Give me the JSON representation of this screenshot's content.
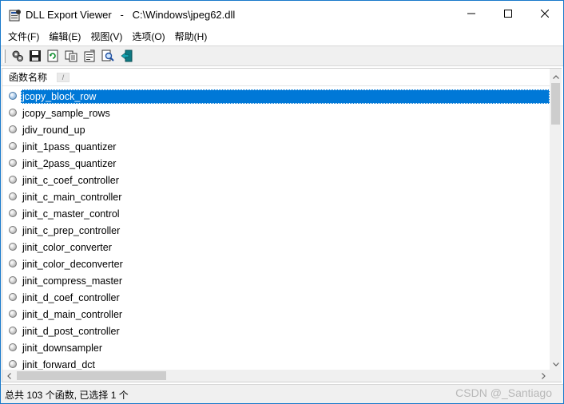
{
  "window": {
    "title": "DLL Export Viewer   -   C:\\Windows\\jpeg62.dll",
    "minimize_icon": "minimize-icon",
    "maximize_icon": "maximize-icon",
    "close_icon": "close-icon"
  },
  "menu": {
    "items": [
      {
        "label": "文件(F)"
      },
      {
        "label": "编辑(E)"
      },
      {
        "label": "视图(V)"
      },
      {
        "label": "选项(O)"
      },
      {
        "label": "帮助(H)"
      }
    ]
  },
  "toolbar": {
    "buttons": [
      {
        "icon": "properties-gear-icon"
      },
      {
        "icon": "save-icon"
      },
      {
        "icon": "refresh-icon"
      },
      {
        "icon": "copy-icon"
      },
      {
        "icon": "html-report-icon"
      },
      {
        "icon": "find-icon"
      },
      {
        "icon": "exit-icon"
      }
    ]
  },
  "list": {
    "column_header": "函数名称",
    "sort_indicator": "/",
    "selected_index": 0,
    "rows": [
      "jcopy_block_row",
      "jcopy_sample_rows",
      "jdiv_round_up",
      "jinit_1pass_quantizer",
      "jinit_2pass_quantizer",
      "jinit_c_coef_controller",
      "jinit_c_main_controller",
      "jinit_c_master_control",
      "jinit_c_prep_controller",
      "jinit_color_converter",
      "jinit_color_deconverter",
      "jinit_compress_master",
      "jinit_d_coef_controller",
      "jinit_d_main_controller",
      "jinit_d_post_controller",
      "jinit_downsampler",
      "jinit_forward_dct"
    ]
  },
  "status": {
    "text": "总共 103 个函数, 已选择 1 个",
    "watermark": "CSDN @_Santiago"
  },
  "colors": {
    "selection": "#0078d7",
    "window_border": "#1979ca"
  }
}
